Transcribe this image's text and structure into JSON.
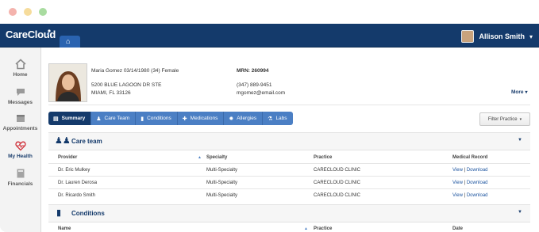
{
  "app": {
    "logo": "CareCloud"
  },
  "user": {
    "name": "Allison Smith"
  },
  "sidebar": {
    "items": [
      {
        "label": "Home",
        "icon": "home-icon"
      },
      {
        "label": "Messages",
        "icon": "messages-icon"
      },
      {
        "label": "Appointments",
        "icon": "appointments-icon"
      },
      {
        "label": "My Health",
        "icon": "heart-icon",
        "active": true
      },
      {
        "label": "Financials",
        "icon": "financials-icon"
      }
    ]
  },
  "patient": {
    "name_line": "Maria Gomez  03/14/1980  (34) Female",
    "address1": "5200 BLUE LAGOON DR STE",
    "address2": "MIAMI, FL 33126",
    "mrn": "MRN: 260994",
    "phone": "(347) 889-9451",
    "email": "mgomez@email.com",
    "more": "More"
  },
  "tabs": [
    {
      "label": "Summary",
      "icon": "summary-icon"
    },
    {
      "label": "Care Team",
      "icon": "care-team-icon"
    },
    {
      "label": "Conditions",
      "icon": "conditions-icon"
    },
    {
      "label": "Medications",
      "icon": "medications-icon"
    },
    {
      "label": "Allergies",
      "icon": "allergies-icon"
    },
    {
      "label": "Labs",
      "icon": "labs-icon"
    }
  ],
  "filter": {
    "label": "Filter Practice"
  },
  "care_team": {
    "title": "Care team",
    "columns": [
      "Provider",
      "Specialty",
      "Practice",
      "Medical Record"
    ],
    "rows": [
      {
        "provider": "Dr. Eric Mulkey",
        "specialty": "Multi-Specialty",
        "practice": "CARECLOUD CLINIC",
        "view": "View",
        "sep": "|",
        "download": "Download"
      },
      {
        "provider": "Dr. Lauren Derosa",
        "specialty": "Multi-Specialty",
        "practice": "CARECLOUD CLINIC",
        "view": "View",
        "sep": "|",
        "download": "Download"
      },
      {
        "provider": "Dr. Ricardo Smith",
        "specialty": "Multi-Specialty",
        "practice": "CARECLOUD CLINIC",
        "view": "View",
        "sep": "|",
        "download": "Download"
      }
    ]
  },
  "conditions": {
    "title": "Conditions",
    "columns": [
      "Name",
      "Practice",
      "Date"
    ]
  },
  "colors": {
    "navy": "#143a6b",
    "tab_blue": "#4b7fc4",
    "link": "#1f56a0",
    "heart": "#d0303a"
  }
}
